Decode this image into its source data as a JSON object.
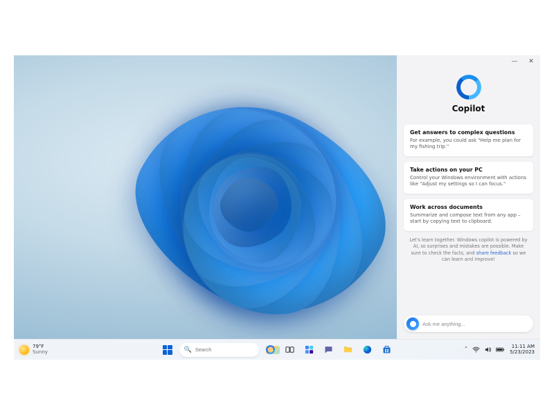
{
  "taskbar": {
    "weather": {
      "temp": "79°F",
      "condition": "Sunny"
    },
    "start_name": "Start",
    "search_placeholder": "Search",
    "icons": [
      {
        "id": "start",
        "name": "start-button"
      },
      {
        "id": "search",
        "name": "search-box"
      },
      {
        "id": "copilot",
        "name": "copilot-button"
      },
      {
        "id": "taskview",
        "name": "task-view-button"
      },
      {
        "id": "widgets",
        "name": "widgets-button"
      },
      {
        "id": "chat",
        "name": "chat-button"
      },
      {
        "id": "explorer",
        "name": "file-explorer-button"
      },
      {
        "id": "edge",
        "name": "edge-button"
      },
      {
        "id": "store",
        "name": "store-button"
      }
    ],
    "tray": {
      "chevron": "˄",
      "wifi": "wifi-icon",
      "volume": "volume-icon",
      "battery": "battery-icon"
    },
    "clock": {
      "time": "11:11 AM",
      "date": "5/23/2023"
    }
  },
  "copilot": {
    "title": "Copilot",
    "cards": [
      {
        "title": "Get answers to complex questions",
        "body": "For example, you could ask \"Help me plan for my fishing trip.\""
      },
      {
        "title": "Take actions on your PC",
        "body": "Control your Windows environment with actions like \"Adjust my settings so I can focus.\""
      },
      {
        "title": "Work across documents",
        "body": "Summarize and compose text from any app – start by copying text to clipboard."
      }
    ],
    "footnote_pre": "Let's learn together. Windows copilot is powered by AI, so surprises and mistakes are possible. Make sure to check the facts, and ",
    "footnote_link": "share feedback",
    "footnote_post": " so we can learn and improve!",
    "input_placeholder": "Ask me anything...",
    "window_controls": {
      "minimize": "—",
      "close": "✕"
    }
  }
}
